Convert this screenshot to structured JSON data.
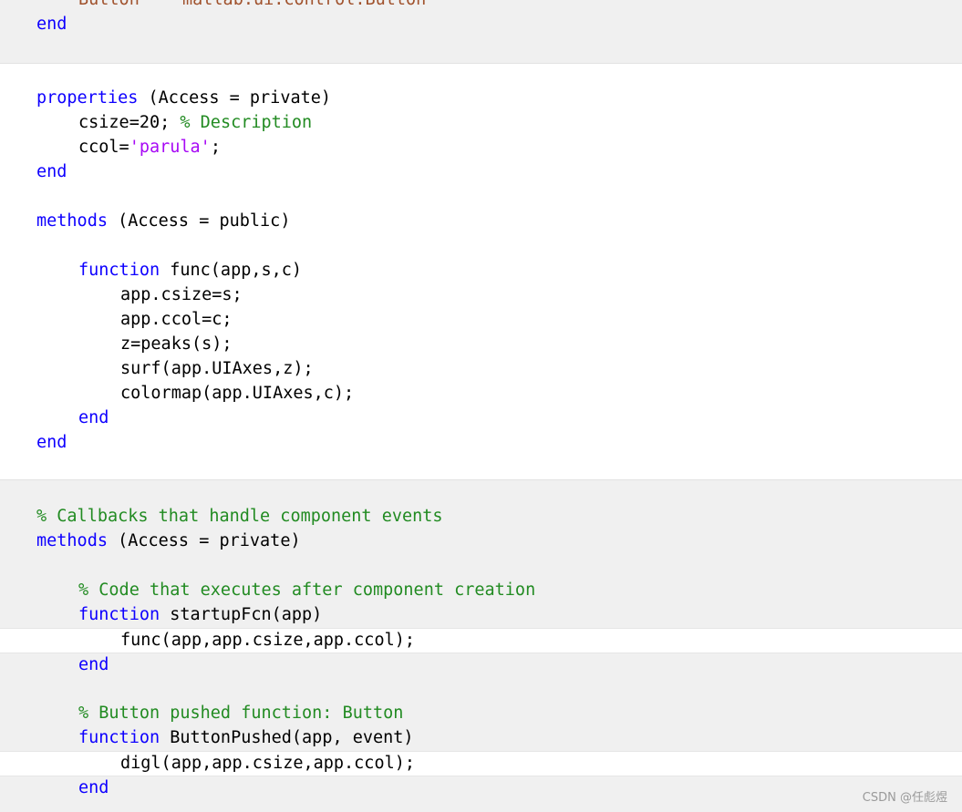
{
  "code": {
    "top_partial_name": "Button",
    "top_partial_type": "matlab.ui.control.Button",
    "kw_end": "end",
    "properties_block": {
      "kw_properties": "properties",
      "access": " (Access = private)",
      "csize_code": "csize=20; ",
      "csize_comment": "% Description",
      "ccol_prefix": "ccol=",
      "ccol_string": "'parula'",
      "ccol_suffix": ";"
    },
    "public_methods": {
      "kw_methods": "methods",
      "access": " (Access = public)",
      "kw_function": "function",
      "signature": " func(app,s,c)",
      "body": [
        "app.csize=s;",
        "app.ccol=c;",
        "z=peaks(s);",
        "surf(app.UIAxes,z);",
        "colormap(app.UIAxes,c);"
      ]
    },
    "callbacks": {
      "comment": "% Callbacks that handle component events",
      "kw_methods": "methods",
      "access": " (Access = private)",
      "startup_comment": "% Code that executes after component creation",
      "kw_function": "function",
      "startup_signature": " startupFcn(app)",
      "startup_body": "func(app,app.csize,app.ccol);",
      "button_comment": "% Button pushed function: Button",
      "button_signature": " ButtonPushed(app, event)",
      "button_body": "digl(app,app.csize,app.ccol);"
    }
  },
  "watermark": "CSDN @任彪煜",
  "colors": {
    "keyword": "#0e00ff",
    "comment": "#228b22",
    "string": "#a709f5",
    "readonly_background": "#f0f0f0",
    "editable_background": "#ffffff"
  }
}
